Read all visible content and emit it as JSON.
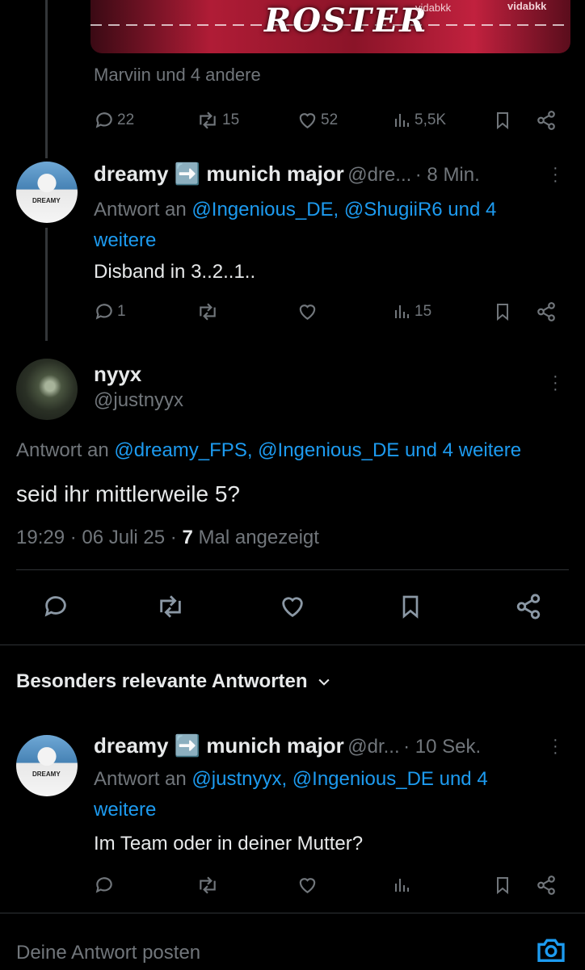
{
  "banner": {
    "title": "ROSTER",
    "brand_left": "vidabkk",
    "brand_right": "vidabkk"
  },
  "top_tweet": {
    "liked_by": "Marviin und 4 andere",
    "replies": "22",
    "retweets": "15",
    "likes": "52",
    "views": "5,5K"
  },
  "reply1": {
    "name": "dreamy ➡️ munich major",
    "handle": "@dre...",
    "time": "· 8 Min.",
    "reply_prefix": "Antwort an",
    "reply_to_line1": "@Ingenious_DE, @ShugiiR6 und 4",
    "reply_to_line2": "weitere",
    "text": "Disband in 3..2..1..",
    "replies": "1",
    "views": "15",
    "avatar_tag": "DREAMY"
  },
  "main_tweet": {
    "name": "nyyx",
    "handle": "@justnyyx",
    "reply_prefix": "Antwort an",
    "reply_to": "@dreamy_FPS, @Ingenious_DE und 4 weitere",
    "text": "seid ihr mittlerweile 5?",
    "timestamp": "19:29 · 06 Juli 25 ·",
    "views_count": "7",
    "views_label": "Mal angezeigt"
  },
  "section": {
    "label": "Besonders relevante Antworten"
  },
  "reply2": {
    "name": "dreamy ➡️ munich major",
    "handle": "@dr...",
    "time": "· 10 Sek.",
    "reply_prefix": "Antwort an",
    "reply_to_line1": "@justnyyx, @Ingenious_DE und 4",
    "reply_to_line2": "weitere",
    "text": "Im Team oder in deiner Mutter?",
    "avatar_tag": "DREAMY"
  },
  "composer": {
    "placeholder": "Deine Antwort posten"
  },
  "colors": {
    "accent": "#1d9bf0",
    "muted": "#71767b",
    "text": "#e7e9ea",
    "background": "#000000"
  }
}
